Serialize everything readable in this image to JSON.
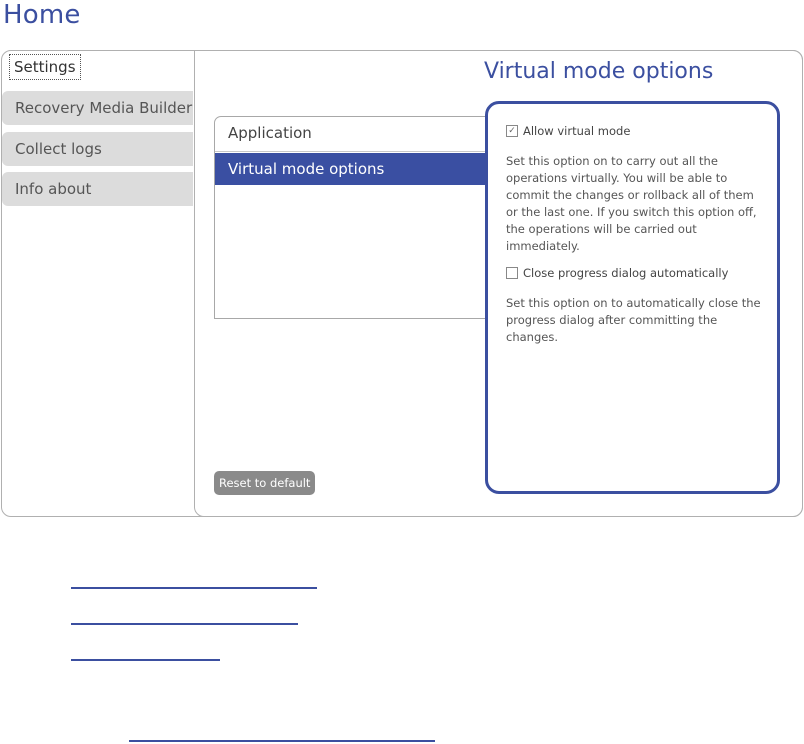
{
  "page": {
    "title": "Home"
  },
  "sidebar": {
    "tabs": [
      {
        "label": "Settings"
      },
      {
        "label": "Recovery Media Builder"
      },
      {
        "label": "Collect logs"
      },
      {
        "label": "Info about"
      }
    ]
  },
  "main": {
    "options_title": "Virtual mode options",
    "tree": {
      "header": "Application",
      "selected_item": "Virtual mode options"
    },
    "options": {
      "allow_virtual_mode": {
        "label": "Allow virtual mode",
        "checked": true,
        "description": "Set this option on to carry out all the operations virtually. You will be able to commit the changes or rollback all of them or the last one. If you switch this option off, the operations will be carried out immediately."
      },
      "close_progress": {
        "label": "Close progress dialog automatically",
        "checked": false,
        "description": "Set this option on to automatically close the progress dialog after committing the changes."
      }
    },
    "reset_label": "Reset to default"
  },
  "colors": {
    "accent": "#3b4fa0",
    "selection": "#3a4fa2",
    "tab_bg": "#dcdcdc",
    "button_bg": "#8a8a8a"
  }
}
